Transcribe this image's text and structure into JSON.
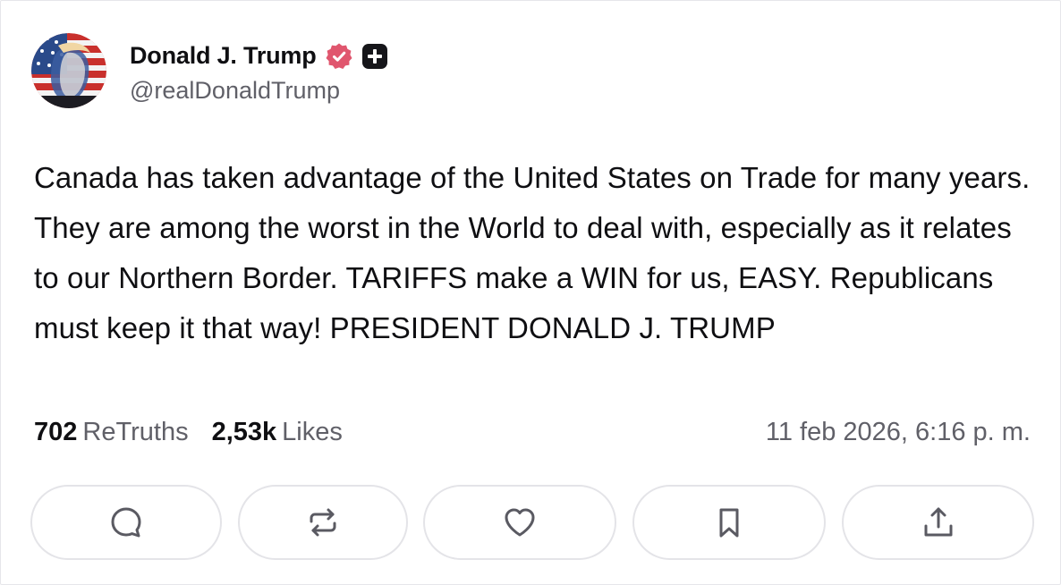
{
  "author": {
    "display_name": "Donald J. Trump",
    "handle": "@realDonaldTrump",
    "verified_color": "#e0566e"
  },
  "post": {
    "text": "Canada has taken advantage of the United States on Trade for many years. They are among the worst in the World to deal with, especially as it relates to our Northern Border. TARIFFS make a WIN for us, EASY. Republicans must keep it that way! PRESIDENT DONALD J. TRUMP"
  },
  "stats": {
    "retruths_count": "702",
    "retruths_label": "ReTruths",
    "likes_count": "2,53k",
    "likes_label": "Likes",
    "timestamp": "11 feb 2026, 6:16 p. m."
  },
  "actions": [
    {
      "icon": "reply-icon"
    },
    {
      "icon": "retruth-icon"
    },
    {
      "icon": "like-icon"
    },
    {
      "icon": "bookmark-icon"
    },
    {
      "icon": "share-icon"
    }
  ]
}
